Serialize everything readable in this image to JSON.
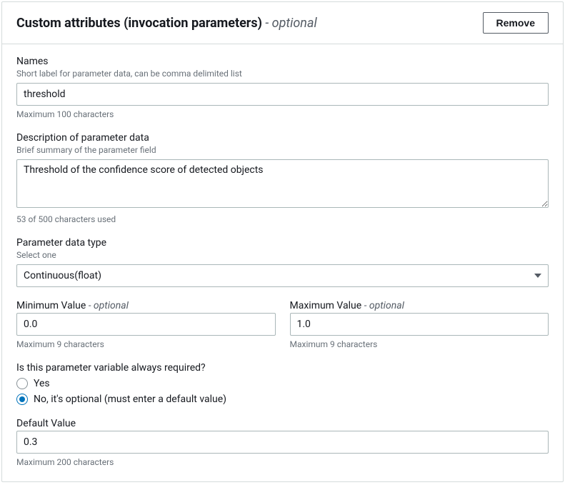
{
  "header": {
    "title": "Custom attributes (invocation parameters)",
    "optional_suffix": " - optional",
    "remove_label": "Remove"
  },
  "names": {
    "label": "Names",
    "sub": "Short label for parameter data, can be comma delimited list",
    "value": "threshold",
    "hint": "Maximum 100 characters"
  },
  "description": {
    "label": "Description of parameter data",
    "sub": "Brief summary of the parameter field",
    "value": "Threshold of the confidence score of detected objects",
    "hint": "53 of 500 characters used"
  },
  "datatype": {
    "label": "Parameter data type",
    "sub": "Select one",
    "value": "Continuous(float)"
  },
  "min": {
    "label": "Minimum Value",
    "optional_suffix": " - optional",
    "value": "0.0",
    "hint": "Maximum 9 characters"
  },
  "max": {
    "label": "Maximum Value",
    "optional_suffix": " - optional",
    "value": "1.0",
    "hint": "Maximum 9 characters"
  },
  "required": {
    "label": "Is this parameter variable always required?",
    "yes": "Yes",
    "no": "No, it's optional (must enter a default value)"
  },
  "default": {
    "label": "Default Value",
    "value": "0.3",
    "hint": "Maximum 200 characters"
  }
}
